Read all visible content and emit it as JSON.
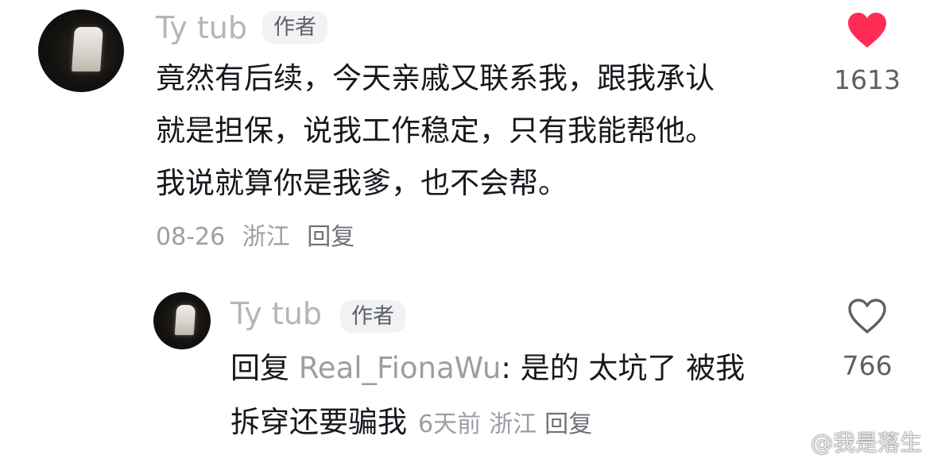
{
  "comments": [
    {
      "username": "Ty tub",
      "badge": "作者",
      "lines": [
        "竟然有后续，今天亲戚又联系我，跟我承认",
        "就是担保，说我工作稳定，只有我能帮他。",
        "我说就算你是我爹，也不会帮。"
      ],
      "date": "08-26",
      "location": "浙江",
      "reply_label": "回复",
      "likes": "1613",
      "liked": true,
      "like_color": "#fe2c55"
    },
    {
      "username": "Ty tub",
      "badge": "作者",
      "reply_prefix": "回复",
      "mention": "Real_FionaWu",
      "text_line1": ": 是的 太坑了 被我",
      "text_line2": "拆穿还要骗我",
      "date": "6天前",
      "location": "浙江",
      "reply_label": "回复",
      "likes": "766",
      "liked": false
    }
  ],
  "watermark": {
    "icon": "weibo-icon",
    "text": "@我是落生"
  }
}
